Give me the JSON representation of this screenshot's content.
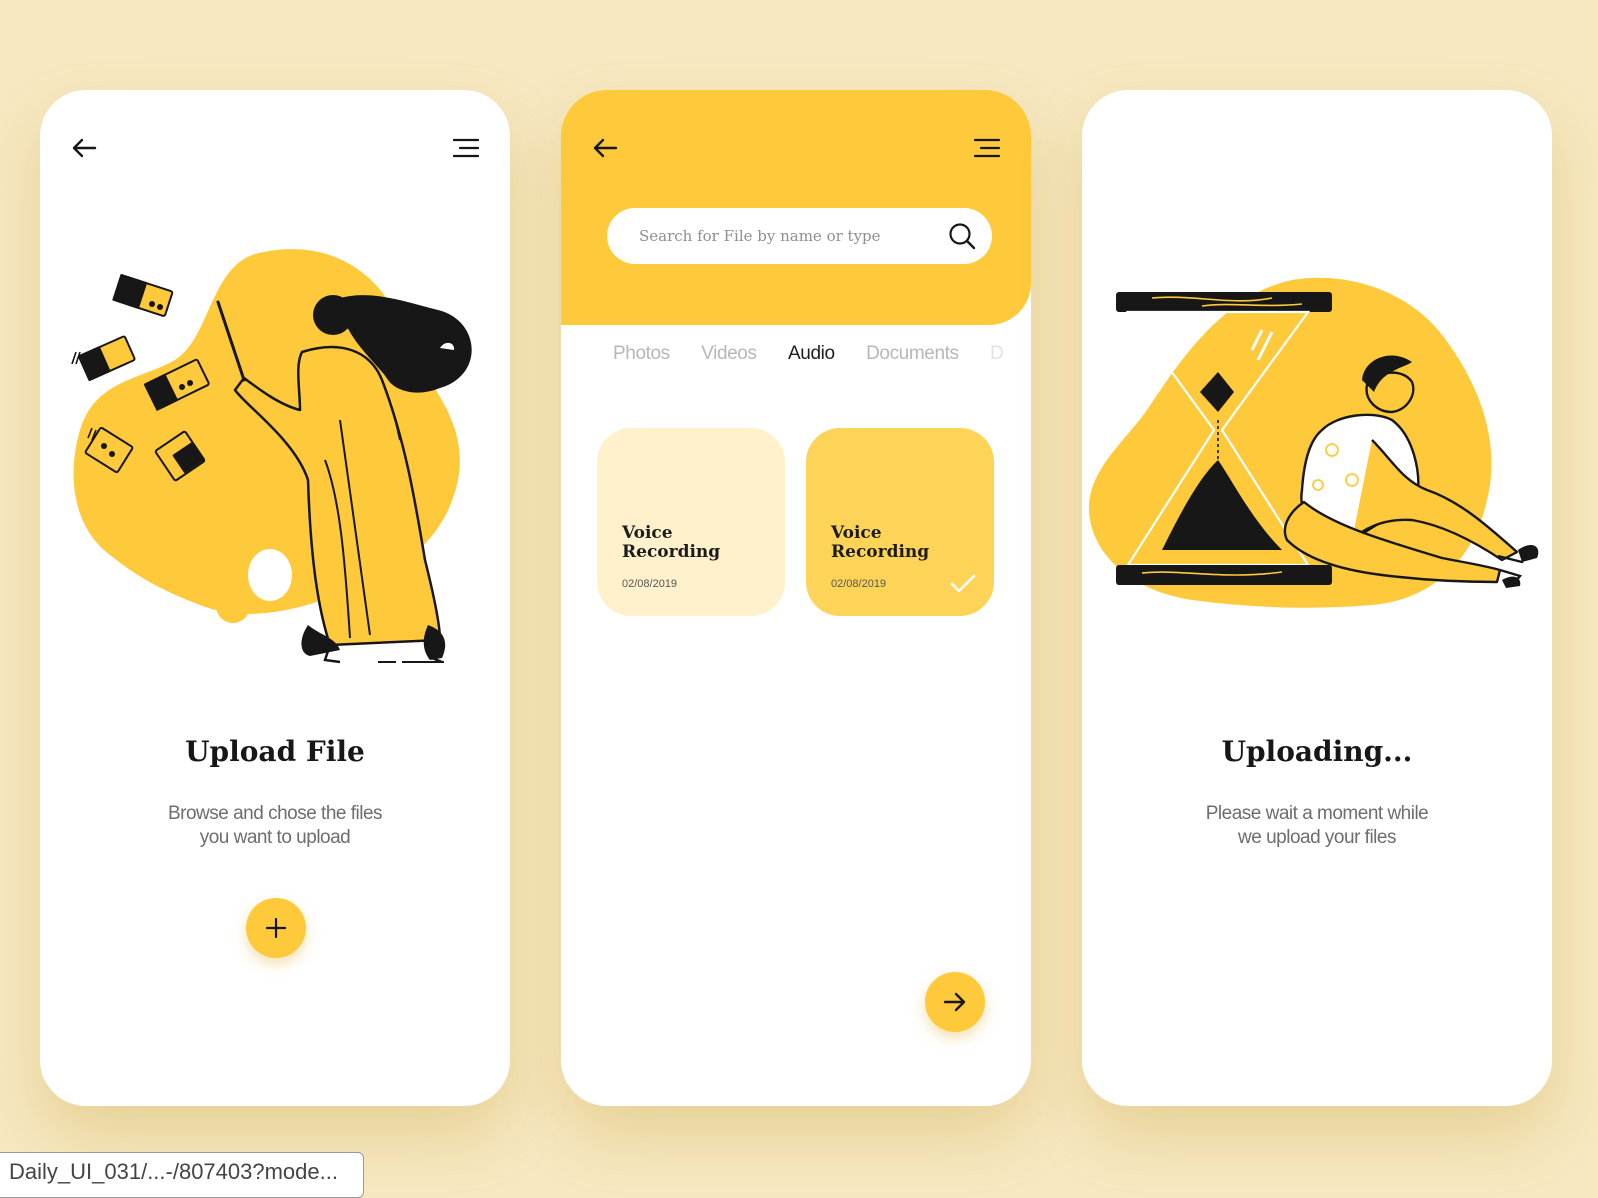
{
  "colors": {
    "background": "#f7e8c1",
    "accent": "#fec93a",
    "ink": "#171717"
  },
  "screens": [
    {
      "icons": {
        "back": "arrow-left-icon",
        "menu": "hamburger-menu-icon",
        "action": "plus-icon"
      },
      "title": "Upload File",
      "desc": [
        "Browse and chose the files",
        "you want to upload"
      ]
    },
    {
      "icons": {
        "back": "arrow-left-icon",
        "menu": "hamburger-menu-icon",
        "search": "search-icon",
        "action": "arrow-right-icon",
        "selected": "check-icon"
      },
      "search": {
        "placeholder": "Search for File by name or type",
        "value": ""
      },
      "tabs": [
        {
          "label": "Photos",
          "active": false
        },
        {
          "label": "Videos",
          "active": false
        },
        {
          "label": "Audio",
          "active": true
        },
        {
          "label": "Documents",
          "active": false
        },
        {
          "label": "D",
          "active": false
        }
      ],
      "files": [
        {
          "name_line1": "Voice",
          "name_line2": "Recording",
          "date": "02/08/2019",
          "selected": false
        },
        {
          "name_line1": "Voice",
          "name_line2": "Recording",
          "date": "02/08/2019",
          "selected": true
        }
      ]
    },
    {
      "icons": {
        "illustration": "hourglass-icon"
      },
      "title": "Uploading...",
      "desc": [
        "Please wait a moment while",
        "we upload your files"
      ]
    }
  ],
  "caption": "Daily_UI_031/...-/807403?mode..."
}
